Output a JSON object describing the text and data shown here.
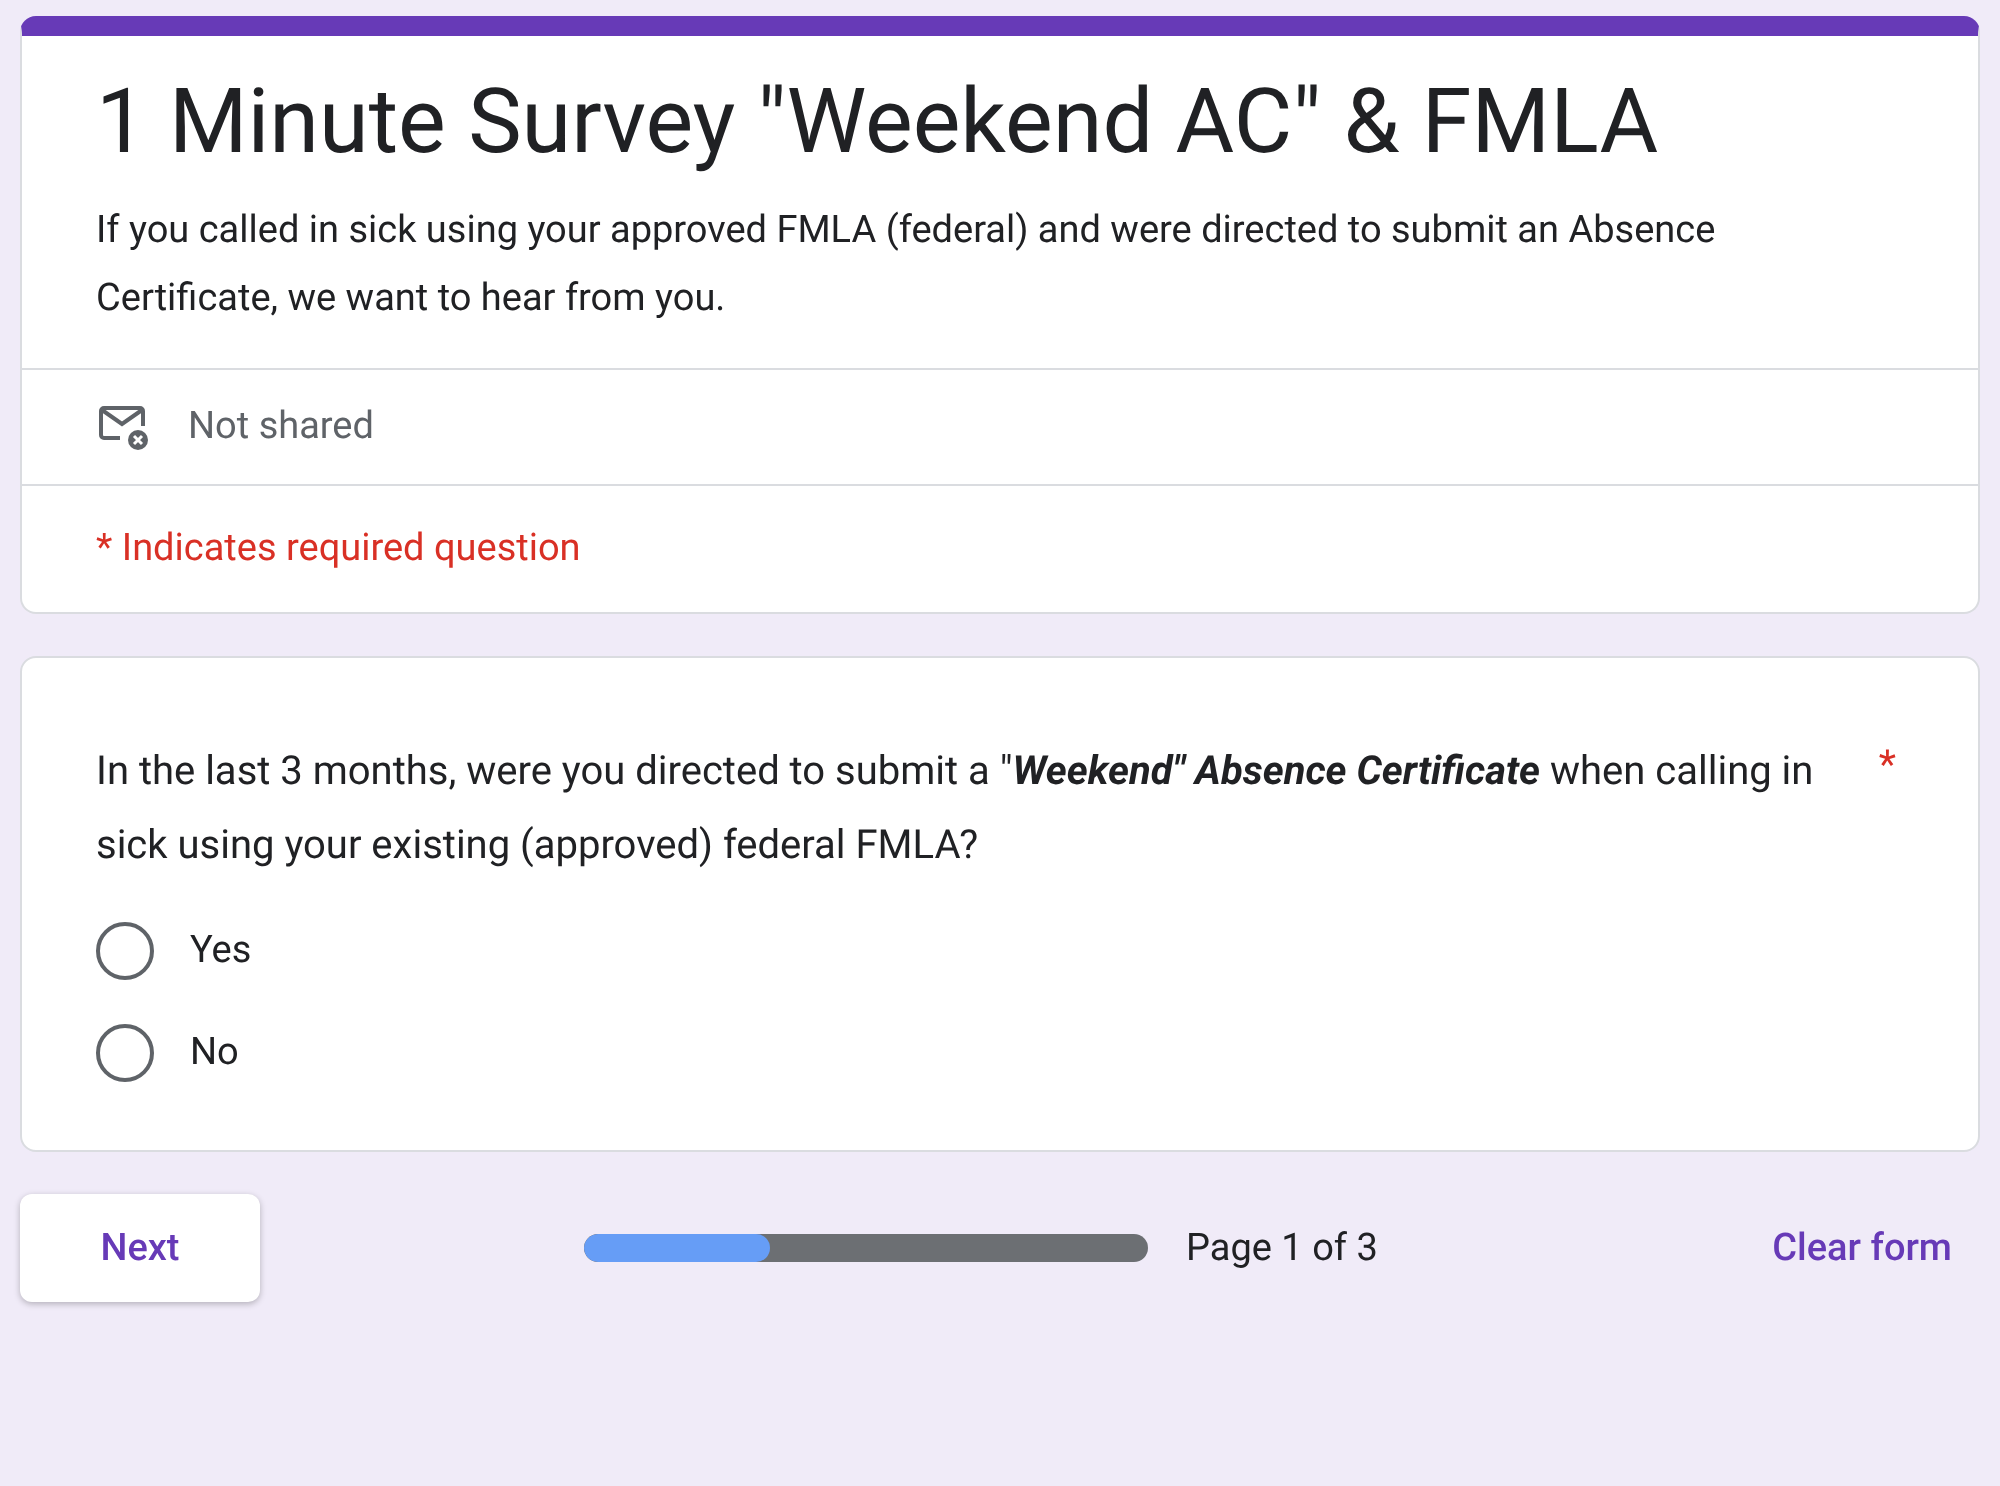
{
  "header": {
    "title": "1 Minute Survey \"Weekend AC\" & FMLA",
    "description": "If you called in sick using your approved FMLA (federal) and were directed to submit an Absence Certificate, we want to hear from you.",
    "email_status": "Not shared",
    "required_note": "* Indicates required question"
  },
  "question": {
    "text": "In the last 3 months, were you directed to submit a \"**Weekend\" Absence Certificate** when calling in sick using your existing (approved) federal FMLA?",
    "required_mark": "*",
    "options": [
      {
        "label": "Yes",
        "selected": false
      },
      {
        "label": "No",
        "selected": false
      }
    ]
  },
  "footer": {
    "next": "Next",
    "progress": {
      "level": 0.33
    },
    "page": "Page 1 of 3",
    "clear": "Clear form"
  }
}
